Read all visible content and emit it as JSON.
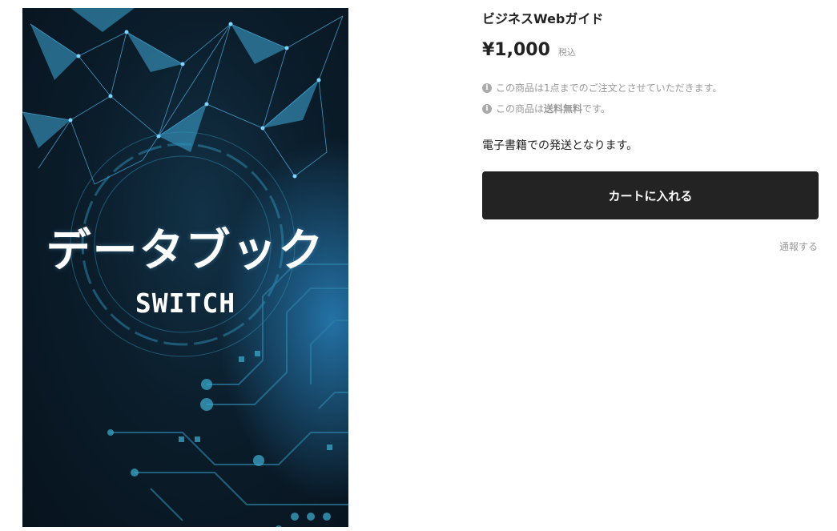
{
  "cover": {
    "title": "データブック",
    "subtitle": "SWITCH"
  },
  "product": {
    "name": "ビジネスWebガイド",
    "price": "¥1,000",
    "tax_label": "税込",
    "notice_order_limit": "この商品は1点までのご注文とさせていただきます。",
    "notice_shipping_prefix": "この商品は",
    "notice_shipping_bold": "送料無料",
    "notice_shipping_suffix": "です。",
    "shipping_method": "電子書籍での発送となります。",
    "cart_button_label": "カートに入れる",
    "report_link_label": "通報する"
  },
  "colors": {
    "button_bg": "#232323",
    "muted_text": "#999999",
    "cover_accent": "#3fa9d8"
  },
  "icons": {
    "notice_icon": "info-icon"
  }
}
